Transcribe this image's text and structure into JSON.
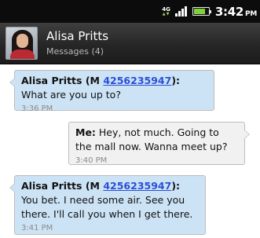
{
  "status_bar": {
    "network_label": "4G",
    "time": "3:42",
    "ampm": "PM",
    "battery_color": "#7fd03a",
    "icons": [
      "network-4g-icon",
      "signal-bars-icon",
      "battery-icon"
    ]
  },
  "header": {
    "contact_name": "Alisa Pritts",
    "subtitle": "Messages (4)"
  },
  "messages": [
    {
      "direction": "incoming",
      "sender_prefix": "Alisa Pritts (M ",
      "phone": "4256235947",
      "sender_suffix": "):",
      "text": " What are you up to?",
      "time": "3:36 PM"
    },
    {
      "direction": "outgoing",
      "sender_prefix": "Me:",
      "text": " Hey, not much. Going to the mall now. Wanna meet up?",
      "time": "3:40 PM"
    },
    {
      "direction": "incoming",
      "sender_prefix": "Alisa Pritts (M ",
      "phone": "4256235947",
      "sender_suffix": "):",
      "text": " You bet. I need some air. See you there. I'll call you when I get there.",
      "time": "3:41 PM"
    }
  ],
  "colors": {
    "incoming_bubble": "#cce3f5",
    "outgoing_bubble": "#f1f1f1",
    "link": "#2a4fd8"
  }
}
